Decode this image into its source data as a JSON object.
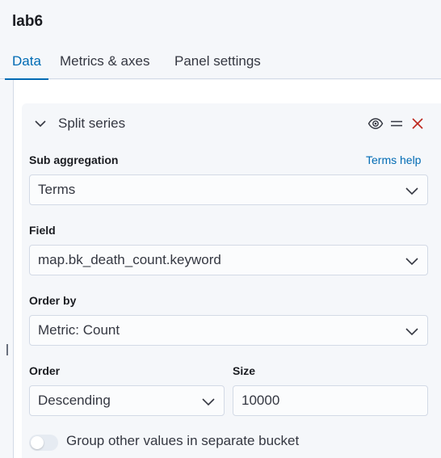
{
  "header": {
    "title": "lab6",
    "tabs": [
      {
        "label": "Data",
        "active": true
      },
      {
        "label": "Metrics & axes",
        "active": false
      },
      {
        "label": "Panel settings",
        "active": false
      }
    ]
  },
  "panel": {
    "title": "Split series",
    "icons": [
      "eye-icon",
      "drag-handle-icon",
      "close-icon"
    ]
  },
  "form": {
    "sub_aggregation": {
      "label": "Sub aggregation",
      "help": "Terms help",
      "value": "Terms"
    },
    "field": {
      "label": "Field",
      "value": "map.bk_death_count.keyword"
    },
    "order_by": {
      "label": "Order by",
      "value": "Metric: Count"
    },
    "order": {
      "label": "Order",
      "value": "Descending"
    },
    "size": {
      "label": "Size",
      "value": "10000"
    },
    "group_other": {
      "label": "Group other values in separate bucket",
      "enabled": false
    }
  },
  "colors": {
    "accent": "#006bb4",
    "danger": "#bd271e",
    "border": "#d3dae6"
  }
}
